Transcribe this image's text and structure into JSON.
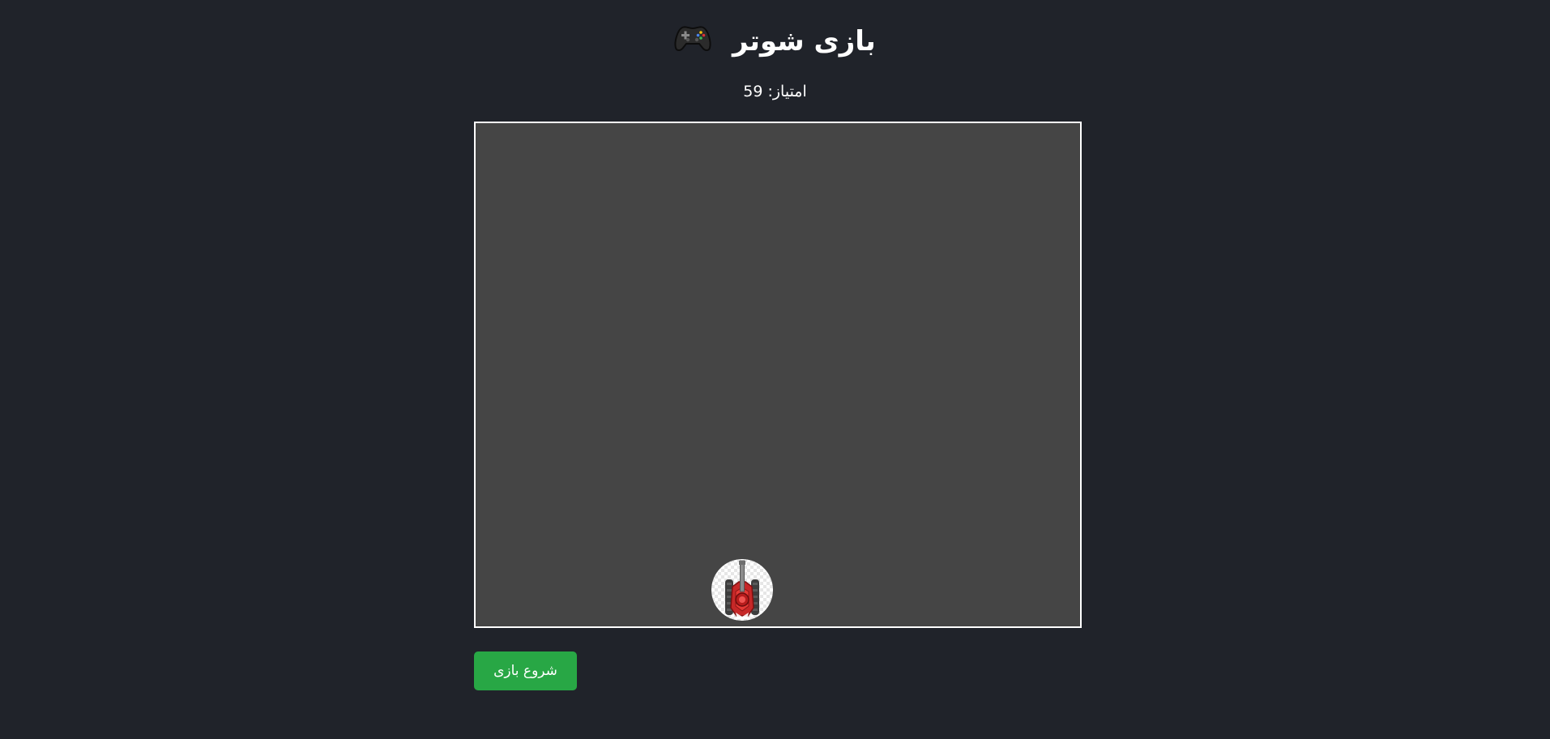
{
  "header": {
    "title": "بازی شوتر",
    "title_icon": "gamepad-icon"
  },
  "score": {
    "label": "امتیاز:",
    "value": "59"
  },
  "game": {
    "player_icon": "red-tank-icon"
  },
  "controls": {
    "start_label": "شروع بازی"
  },
  "colors": {
    "page_background": "#20232a",
    "canvas_background": "#454545",
    "canvas_border": "#ffffff",
    "start_button": "#28a745",
    "tank_red": "#c62828"
  }
}
